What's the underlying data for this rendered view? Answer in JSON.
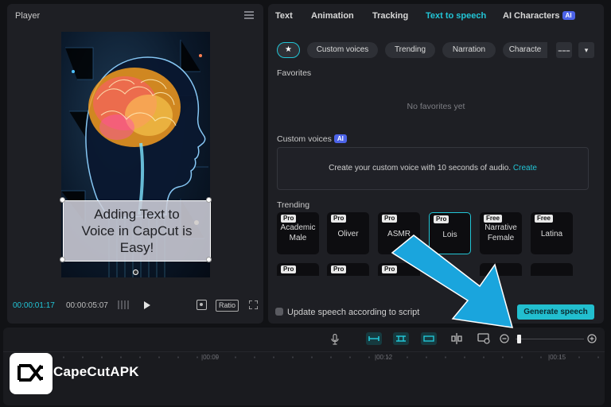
{
  "player": {
    "title": "Player",
    "caption": "Adding Text to\nVoice in CapCut is\nEasy!",
    "time_current": "00:00:01:17",
    "time_total": "00:00:05:07",
    "ratio_label": "Ratio"
  },
  "tts_panel": {
    "tabs": [
      {
        "label": "Text"
      },
      {
        "label": "Animation"
      },
      {
        "label": "Tracking"
      },
      {
        "label": "Text to speech"
      },
      {
        "label": "AI Characters",
        "badge": "AI"
      }
    ],
    "active_tab": "Text to speech",
    "chips": [
      {
        "label": "★"
      },
      {
        "label": "Custom voices"
      },
      {
        "label": "Trending"
      },
      {
        "label": "Narration"
      },
      {
        "label": "Characte"
      }
    ],
    "favorites": {
      "label": "Favorites",
      "empty_text": "No favorites yet"
    },
    "custom_voices": {
      "label": "Custom voices",
      "badge": "AI",
      "prompt": "Create your custom voice with 10 seconds of audio.",
      "link": "Create"
    },
    "trending": {
      "label": "Trending",
      "voices_row1": [
        {
          "badge": "Pro",
          "name": "Academic\nMale"
        },
        {
          "badge": "Pro",
          "name": "Oliver"
        },
        {
          "badge": "Pro",
          "name": "ASMR"
        },
        {
          "badge": "Pro",
          "name": "Lois",
          "selected": true
        },
        {
          "badge": "Free",
          "name": "Narrative\nFemale"
        },
        {
          "badge": "Free",
          "name": "Latina"
        }
      ],
      "voices_row2": [
        {
          "badge": "Pro"
        },
        {
          "badge": "Pro"
        },
        {
          "badge": "Pro"
        }
      ]
    },
    "update_checkbox_label": "Update speech according to script",
    "generate_button": "Generate speech"
  },
  "timeline": {
    "ticks": [
      "|00:09",
      "|00:12",
      "|00:15"
    ]
  },
  "watermark": {
    "text": "CapeCutAPK"
  },
  "colors": {
    "accent": "#22c5d6",
    "arrow": "#1aa5dd",
    "ai_badge": "#4c63e8"
  }
}
